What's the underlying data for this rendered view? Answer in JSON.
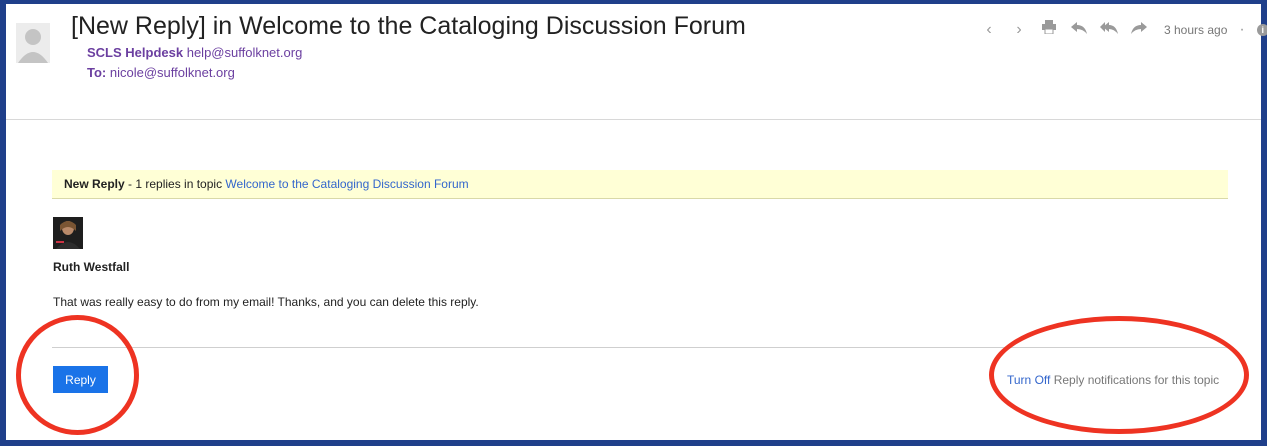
{
  "email": {
    "subject": "[New Reply] in Welcome to the Cataloging Discussion Forum",
    "sender_name": "SCLS Helpdesk",
    "sender_email": "help@suffolknet.org",
    "to_label": "To:",
    "to_email": "nicole@suffolknet.org",
    "timestamp": "3 hours ago",
    "separator": "·"
  },
  "toolbar": {
    "icons": [
      "chevron-left-icon",
      "chevron-right-icon",
      "print-icon",
      "reply-icon",
      "reply-all-icon",
      "forward-icon",
      "info-icon",
      "more-icon"
    ]
  },
  "banner": {
    "label": "New Reply",
    "middle": " - 1 replies in topic ",
    "topic_link": "Welcome to the Cataloging Discussion Forum"
  },
  "post": {
    "author": "Ruth Westfall",
    "text": "That was really easy to do from my email!  Thanks, and you can delete this reply."
  },
  "footer": {
    "reply_button": "Reply",
    "turn_off_link": "Turn Off",
    "notif_text": " Reply notifications for this topic"
  },
  "annotations": {
    "ring_color": "#ee3322"
  }
}
